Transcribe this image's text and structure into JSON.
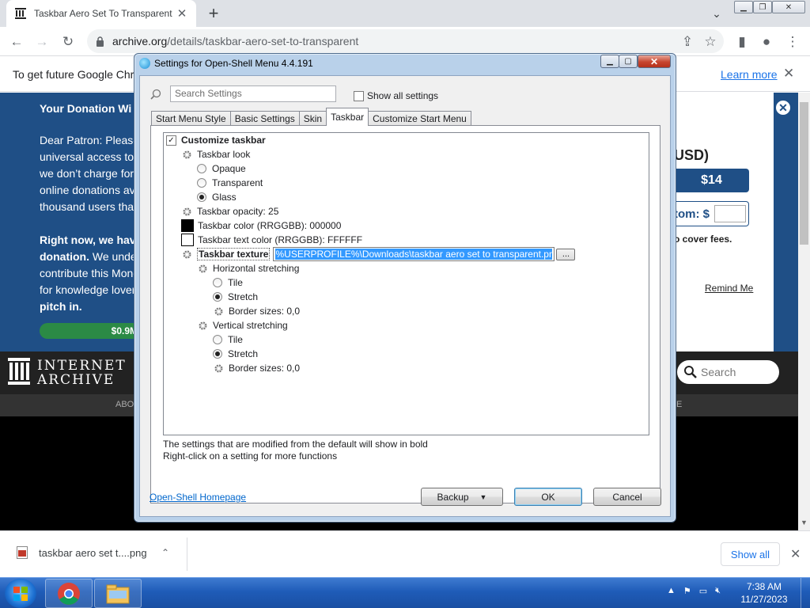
{
  "browser": {
    "tab_title": "Taskbar Aero Set To Transparent",
    "url_domain": "archive.org",
    "url_path": "/details/taskbar-aero-set-to-transparent",
    "infobar_text": "To get future Google Chro",
    "infobar_link": "Learn more"
  },
  "donation": {
    "title": "Your Donation Wi",
    "para1": "Dear Patron: Please\nuniversal access to\nwe don’t charge for\nonline donations ave\nthousand users that",
    "para2_bold": "Right now, we have\ndonation.",
    "para2_rest": " We unde\ncontribute this Mond\nfor knowledge lovers",
    "para2_end": "pitch in.",
    "progress_label": "$0.9M",
    "currency_heading": "USD)",
    "amount": "$14",
    "custom_label": "tom: $",
    "fees_text": "o cover fees.",
    "remind": "Remind Me"
  },
  "ia": {
    "logo_line1": "INTERNET",
    "logo_line2": "ARCHIVE",
    "search_placeholder": "Search",
    "nav_left": "ABO",
    "nav_right": "E"
  },
  "downloads": {
    "file": "taskbar aero set t....png",
    "show_all": "Show all"
  },
  "taskbar": {
    "time": "7:38 AM",
    "date": "11/27/2023"
  },
  "dialog": {
    "title": "Settings for Open-Shell Menu 4.4.191",
    "search_placeholder": "Search Settings",
    "show_all_label": "Show all settings",
    "tabs": [
      "Start Menu Style",
      "Basic Settings",
      "Skin",
      "Taskbar",
      "Customize Start Menu"
    ],
    "active_tab": "Taskbar",
    "settings": {
      "customize_taskbar": "Customize taskbar",
      "taskbar_look": "Taskbar look",
      "opaque": "Opaque",
      "transparent": "Transparent",
      "glass": "Glass",
      "opacity": "Taskbar opacity: 25",
      "color": "Taskbar color (RRGGBB): 000000",
      "text_color": "Taskbar text color (RRGGBB): FFFFFF",
      "texture": "Taskbar texture",
      "texture_value": "%USERPROFILE%\\Downloads\\taskbar aero set to transparent.png",
      "browse": "...",
      "h_stretch": "Horizontal stretching",
      "v_stretch": "Vertical stretching",
      "tile": "Tile",
      "stretch": "Stretch",
      "border_sizes": "Border sizes: 0,0"
    },
    "note1": "The settings that are modified from the default will show in bold",
    "note2": "Right-click on a setting for more functions",
    "homepage": "Open-Shell Homepage",
    "backup": "Backup",
    "ok": "OK",
    "cancel": "Cancel",
    "colors": {
      "swatch_color": "#000000",
      "swatch_text": "#FFFFFF"
    }
  }
}
